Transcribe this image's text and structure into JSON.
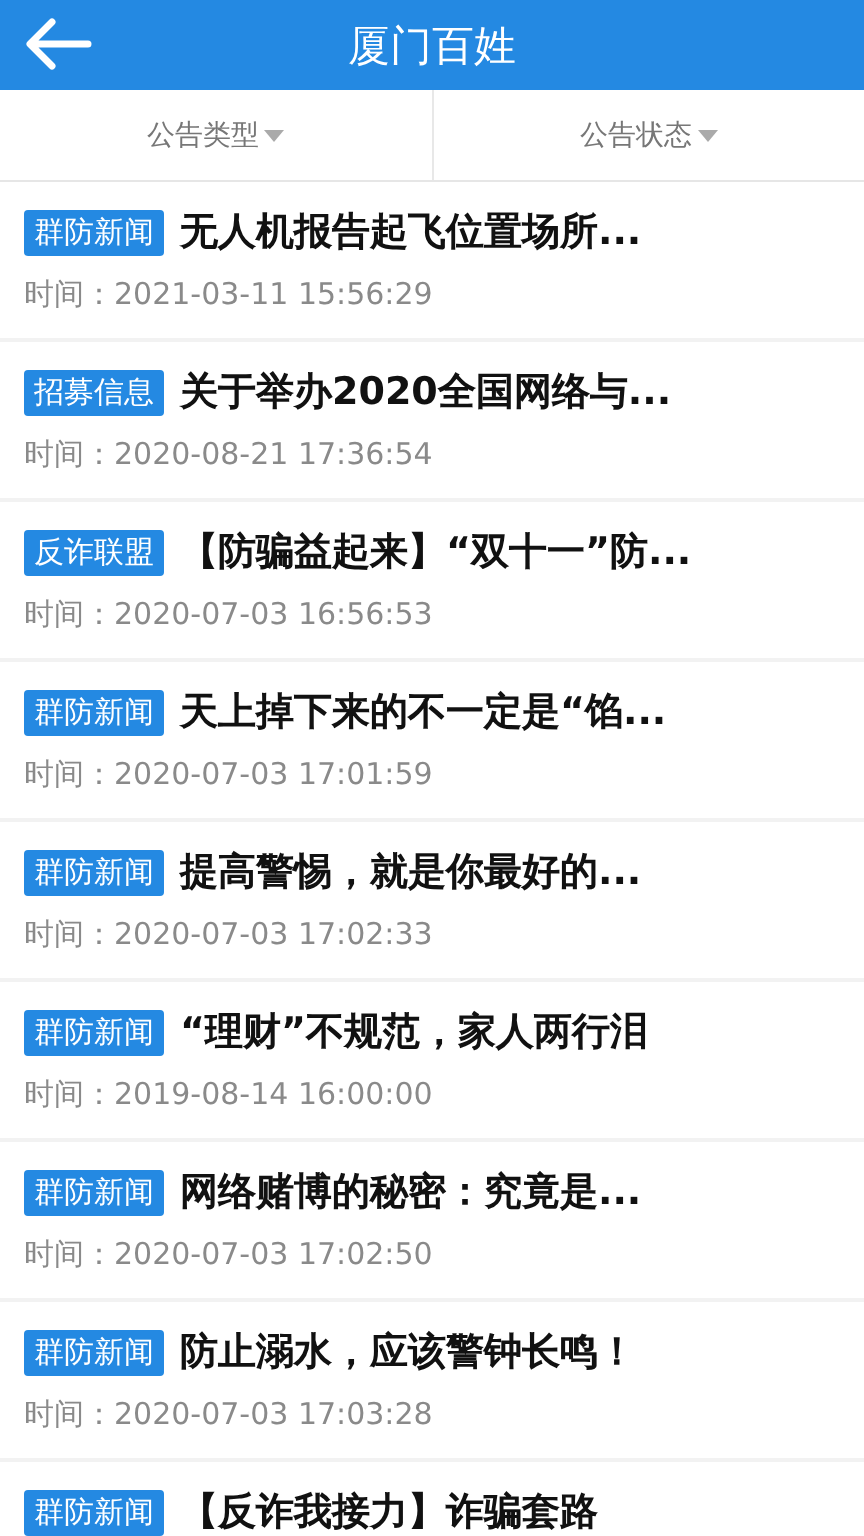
{
  "header": {
    "title": "厦门百姓"
  },
  "filters": [
    {
      "label": "公告类型"
    },
    {
      "label": "公告状态"
    }
  ],
  "items": [
    {
      "tag": "群防新闻",
      "title": "无人机报告起飞位置场所...",
      "time": "时间：2021-03-11 15:56:29"
    },
    {
      "tag": "招募信息",
      "title": "关于举办2020全国网络与...",
      "time": "时间：2020-08-21 17:36:54"
    },
    {
      "tag": "反诈联盟",
      "title": "【防骗益起来】“双十一”防...",
      "time": "时间：2020-07-03 16:56:53"
    },
    {
      "tag": "群防新闻",
      "title": "天上掉下来的不一定是“馅...",
      "time": "时间：2020-07-03 17:01:59"
    },
    {
      "tag": "群防新闻",
      "title": "提高警惕，就是你最好的...",
      "time": "时间：2020-07-03 17:02:33"
    },
    {
      "tag": "群防新闻",
      "title": "“理财”不规范，家人两行泪",
      "time": "时间：2019-08-14 16:00:00"
    },
    {
      "tag": "群防新闻",
      "title": "网络赌博的秘密：究竟是...",
      "time": "时间：2020-07-03 17:02:50"
    },
    {
      "tag": "群防新闻",
      "title": "防止溺水，应该警钟长鸣！",
      "time": "时间：2020-07-03 17:03:28"
    },
    {
      "tag": "群防新闻",
      "title": "【反诈我接力】诈骗套路"
    }
  ]
}
